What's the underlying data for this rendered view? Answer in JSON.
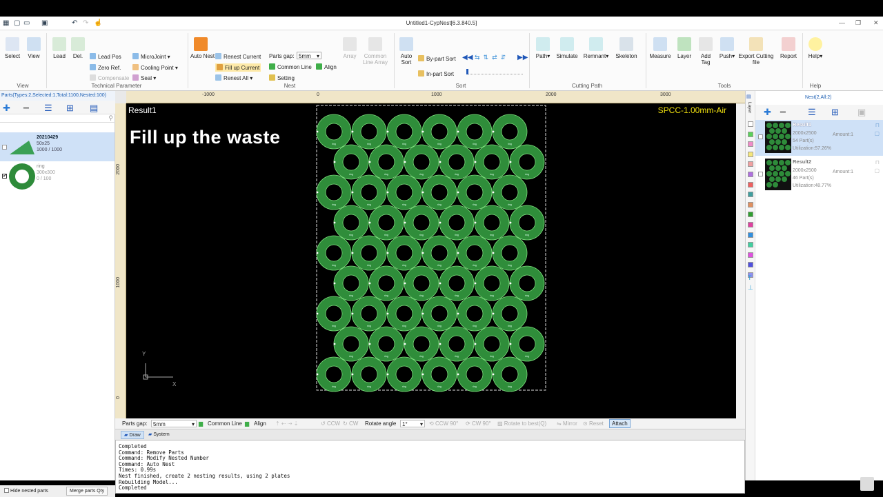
{
  "window": {
    "title": "Untitled1-CypNest[6.3.840.5]"
  },
  "ribbon": {
    "view_group": {
      "select": "Select",
      "view": "View",
      "label": "View"
    },
    "tech_group": {
      "lead": "Lead",
      "del": "Del.",
      "lead_pos": "Lead Pos",
      "zero_ref": "Zero Ref.",
      "compensate": "Compensate",
      "microjoint": "MicroJoint",
      "cooling_point": "Cooling Point",
      "seal": "Seal",
      "label": "Technical Parameter"
    },
    "nest_group": {
      "auto_nest": "Auto Nest",
      "renest_current": "Renest Current",
      "fill_up_current": "Fill up Current",
      "renest_all": "Renest All",
      "parts_gap_label": "Parts gap:",
      "parts_gap_value": "5mm",
      "common_line": "Common Line",
      "align": "Align",
      "setting": "Setting",
      "array": "Array",
      "common_line_array": "Common Line Array",
      "label": "Nest"
    },
    "sort_group": {
      "auto_sort": "Auto Sort",
      "by_part_sort": "By-part Sort",
      "in_part_sort": "In-part Sort",
      "label": "Sort"
    },
    "cutting_group": {
      "path": "Path",
      "simulate": "Simulate",
      "remnant": "Remnant",
      "skeleton": "Skeleton",
      "label": "Cutting Path"
    },
    "tools_group": {
      "measure": "Measure",
      "layer": "Layer",
      "add_tag": "Add Tag",
      "push": "Push",
      "export": "Export Cutting file",
      "report": "Report",
      "label": "Tools"
    },
    "help_group": {
      "help": "Help",
      "label": "Help"
    }
  },
  "parts_panel": {
    "header": "Parts(Types:2,Selected:1,Total:1100,Nested:100)",
    "items": [
      {
        "name": "20210429",
        "size": "50x25",
        "count": "1000 / 1000",
        "selected": true,
        "checked": false
      },
      {
        "name": "ring",
        "size": "300x300",
        "count": "0 / 100",
        "selected": false,
        "checked": true
      }
    ],
    "hide_nested": "Hide nested parts",
    "merge_qty": "Merge parts Qty"
  },
  "canvas": {
    "result_label": "Result1",
    "material": "SPCC-1.00mm-Air",
    "overlay_text": "Fill up the waste",
    "ruler_top": [
      "-1000",
      "0",
      "1000",
      "2000",
      "3000"
    ],
    "ruler_left": [
      "2000",
      "1000",
      "0"
    ],
    "axis_x": "X",
    "axis_y": "Y",
    "ring_label": "ring"
  },
  "bottombar": {
    "parts_gap_label": "Parts gap:",
    "parts_gap_value": "5mm",
    "common_line": "Common Line",
    "align": "Align",
    "ccw": "CCW",
    "cw": "CW",
    "rotate_angle": "Rotate angle",
    "rotate_value": "1°",
    "ccw90": "CCW 90°",
    "cw90": "CW 90°",
    "rotate_best": "Rotate to best(Q)",
    "mirror": "Mirror",
    "reset": "Reset",
    "attach": "Attach"
  },
  "tabs": {
    "draw": "Draw",
    "system": "System"
  },
  "console": {
    "lines": [
      "Completed",
      "Command: Remove Parts",
      "Command: Modify Nested Number",
      "Command: Auto Nest",
      "Times: 0.99s",
      "Nest finished, create 2 nesting results, using 2 plates",
      "Rebuilding Model...",
      "Completed"
    ]
  },
  "nest_panel": {
    "header": "Nest(2,All:2)",
    "layer_label": "Layer",
    "results": [
      {
        "name": "Result1",
        "size": "2000x2500",
        "parts": "54 Part(s)",
        "utilization": "Utilization:57.26%",
        "amount": "Amount:1"
      },
      {
        "name": "Result2",
        "size": "2000x2500",
        "parts": "46 Part(s)",
        "utilization": "Utilization:48.77%",
        "amount": "Amount:1"
      }
    ],
    "layer_colors": [
      "#ffffff",
      "#5ad25a",
      "#f08cc8",
      "#f5e67a",
      "#f0a0a0",
      "#b070e0",
      "#f06060",
      "#40a0a0",
      "#e09060",
      "#30a030",
      "#e040a0",
      "#3090e0",
      "#40d0a0",
      "#e050e0",
      "#5050e0",
      "#9090f0"
    ]
  }
}
